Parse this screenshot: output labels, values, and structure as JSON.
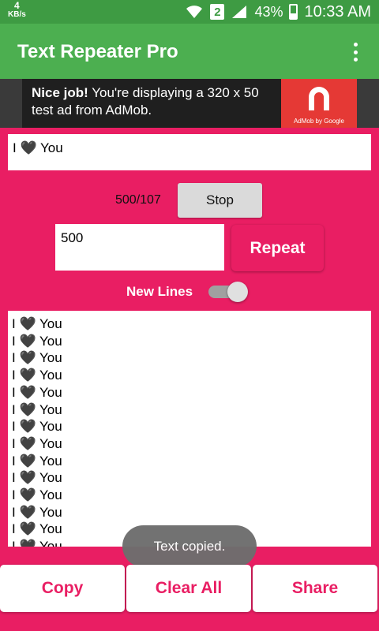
{
  "status_bar": {
    "speed_value": "4",
    "speed_unit": "KB/s",
    "sim_slot": "2",
    "battery": "43%",
    "time": "10:33 AM"
  },
  "app_bar": {
    "title": "Text Repeater Pro",
    "menu_icon": "overflow-menu-icon"
  },
  "ad_banner": {
    "headline": "Nice job!",
    "body": "You're displaying a 320 x 50 test ad from AdMob.",
    "brand": "AdMob by Google"
  },
  "input": {
    "value": "I 🖤 You"
  },
  "counter": "500/107",
  "stop_label": "Stop",
  "repeat_count": "500",
  "repeat_label": "Repeat",
  "new_lines": {
    "label": "New Lines",
    "enabled": true
  },
  "output": {
    "lines": [
      "I 🖤 You",
      "I 🖤 You",
      "I 🖤 You",
      "I 🖤 You",
      "I 🖤 You",
      "I 🖤 You",
      "I 🖤 You",
      "I 🖤 You",
      "I 🖤 You",
      "I 🖤 You",
      "I 🖤 You",
      "I 🖤 You",
      "I 🖤 You",
      "I 🖤 You"
    ]
  },
  "toast": "Text copied.",
  "bottom_buttons": {
    "copy": "Copy",
    "clear_all": "Clear All",
    "share": "Share"
  },
  "colors": {
    "primary": "#4CAF50",
    "accent": "#E91E63"
  }
}
